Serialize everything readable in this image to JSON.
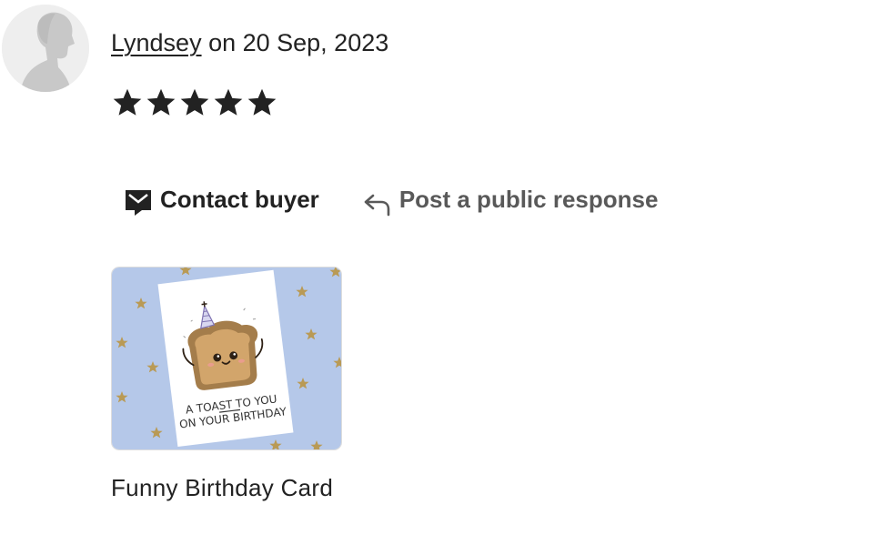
{
  "review": {
    "reviewer_name": "Lyndsey",
    "date_text": " on 20 Sep, 2023",
    "rating": 5,
    "rating_max": 5
  },
  "actions": {
    "contact_label": "Contact buyer",
    "response_label": "Post a public response"
  },
  "product": {
    "title": "Funny Birthday Card",
    "card_line_1": "A TOAST TO YOU",
    "card_line_2": "ON YOUR BIRTHDAY"
  },
  "icons": {
    "avatar": "default-user-silhouette",
    "star": "star-icon",
    "contact": "envelope-icon",
    "response": "reply-arrow-icon"
  },
  "colors": {
    "text": "#222222",
    "muted_text": "#595959",
    "star": "#222222",
    "avatar_background": "#eeeeee",
    "product_background": "#b5c8e9"
  }
}
